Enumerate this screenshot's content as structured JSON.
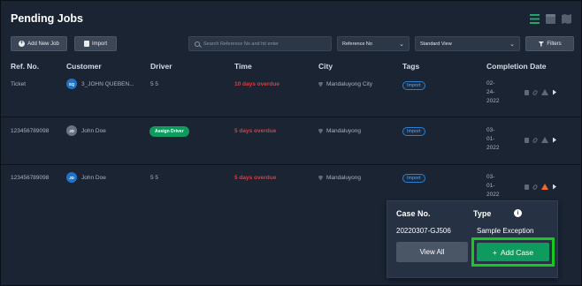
{
  "page": {
    "title": "Pending Jobs"
  },
  "view_icons": [
    "list-view-icon",
    "calendar-view-icon",
    "map-view-icon"
  ],
  "toolbar": {
    "add_new_job": "Add New Job",
    "import": "Import",
    "search_placeholder": "Search Reference No and hit enter",
    "reference_select": "Reference No",
    "view_select": "Standard View",
    "filters": "Filters"
  },
  "table": {
    "headers": {
      "ref": "Ref. No.",
      "customer": "Customer",
      "driver": "Driver",
      "time": "Time",
      "city": "City",
      "tags": "Tags",
      "completion": "Completion Date"
    },
    "rows": [
      {
        "ref": "Ticket",
        "avatar": "SQ",
        "customer": "3_JOHN QUEBEN...",
        "driver": "5 5",
        "time": "10 days overdue",
        "city": "Mandaluyong City",
        "tag": "Import",
        "completion": [
          "02-",
          "24-",
          "2022"
        ]
      },
      {
        "ref": "123456789098",
        "avatar": "JD",
        "customer": "John Doe",
        "driver_button": "Assign Driver",
        "time": "5 days overdue",
        "city": "Mandaluyong",
        "tag": "Import",
        "completion": [
          "03-",
          "01-",
          "2022"
        ]
      },
      {
        "ref": "123456789098",
        "avatar": "JD",
        "customer": "John Doe",
        "driver": "5 5",
        "time": "5 days overdue",
        "city": "Mandaluyong",
        "tag": "Import",
        "completion": [
          "03-",
          "01-",
          "2022"
        ]
      }
    ]
  },
  "popup": {
    "case_no_label": "Case No.",
    "type_label": "Type",
    "case_no": "20220307-GJ506",
    "type": "Sample Exception",
    "view_all": "View All",
    "add_case": "Add Case"
  },
  "colors": {
    "background": "#1a2433",
    "overdue": "#e23b3b",
    "accent_green": "#0f9a5e",
    "tag_blue": "#2b7fd0",
    "highlight": "#16c81f",
    "warning": "#ef6a2a"
  }
}
